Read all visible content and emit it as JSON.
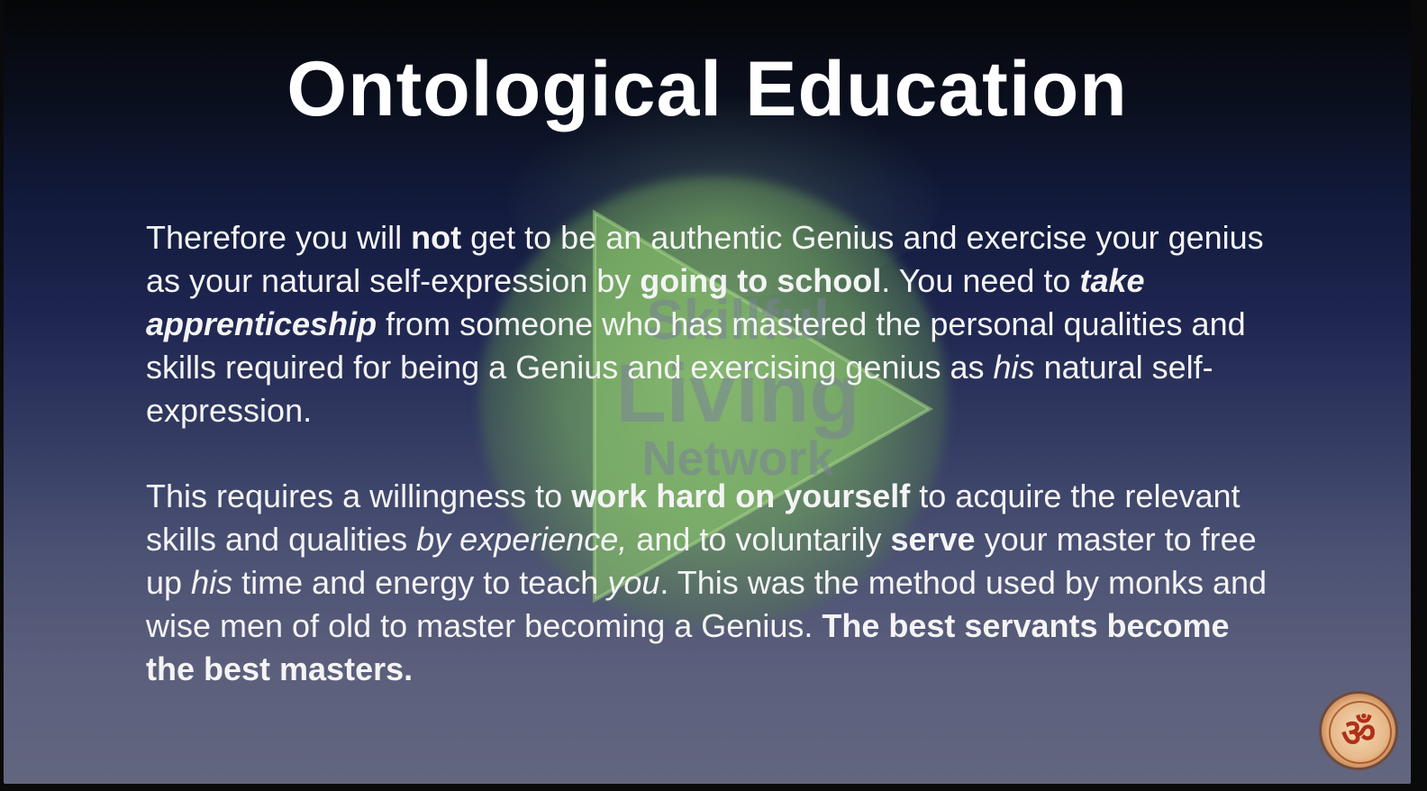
{
  "slide": {
    "title": "Ontological Education",
    "paragraph1": {
      "t1": "Therefore you will ",
      "b1": "not",
      "t2": " get to be an authentic Genius and exercise your genius as your natural self-expression by ",
      "b2": "going to school",
      "t3": ". You need to ",
      "bi1": "take apprenticeship",
      "t4": " from someone who has mastered the personal qualities and skills required for being a Genius and exercising genius as ",
      "i1": "his",
      "t5": " natural self-expression."
    },
    "paragraph2": {
      "t1": "This requires a willingness to ",
      "b1": "work hard on yourself",
      "t2": " to acquire the relevant skills and qualities ",
      "i1": "by experience,",
      "t3": " and to voluntarily ",
      "b2": "serve",
      "t4": " your master to free up ",
      "i2": "his",
      "t5": " time and energy to teach ",
      "i3": "you",
      "t6": ". This was the method used by monks and wise men of old to master becoming a Genius. ",
      "b3": "The best servants become the best masters."
    }
  },
  "watermark": {
    "line1": "Skillful",
    "line2": "Living",
    "line3": "Network"
  },
  "logo": {
    "symbol": "ॐ",
    "icon": "om-logo-icon"
  }
}
